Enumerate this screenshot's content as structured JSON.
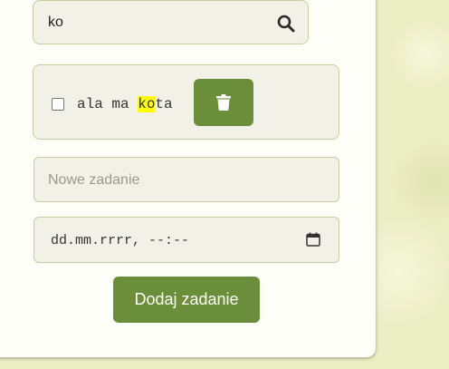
{
  "search": {
    "value": "ko",
    "icon": "search-icon"
  },
  "task": {
    "text_before": "ala ma ",
    "highlight": "ko",
    "text_after": "ta",
    "checked": false,
    "delete_icon": "trash-icon"
  },
  "new_task": {
    "placeholder": "Nowe zadanie"
  },
  "date": {
    "placeholder": "dd.mm.rrrr, --:--",
    "icon": "calendar-icon"
  },
  "add_button": {
    "label": "Dodaj zadanie"
  },
  "colors": {
    "accent": "#6b8e3a",
    "highlight": "#ffff00",
    "field_bg": "#f2f1e7",
    "field_border": "#c9cc9c",
    "page_bg": "#eceec4"
  }
}
